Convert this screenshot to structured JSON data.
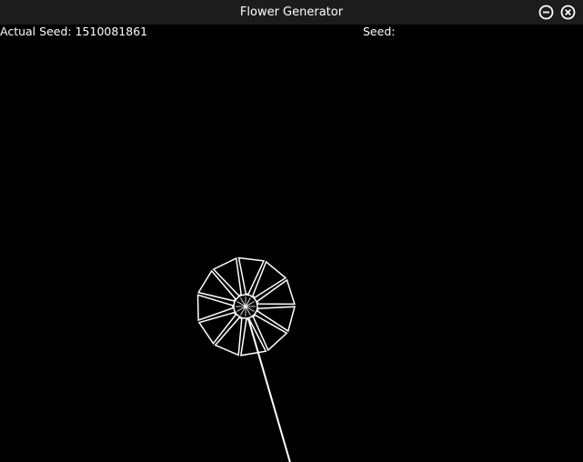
{
  "window": {
    "title": "Flower Generator",
    "minimize_icon": "minus-circle-icon",
    "close_icon": "x-circle-icon"
  },
  "info": {
    "actual_seed_label": "Actual Seed:",
    "actual_seed_value": "1510081861",
    "seed_label": "Seed:",
    "seed_value": ""
  },
  "colors": {
    "background": "#000000",
    "titlebar": "#1c1c1c",
    "foreground": "#ffffff"
  }
}
